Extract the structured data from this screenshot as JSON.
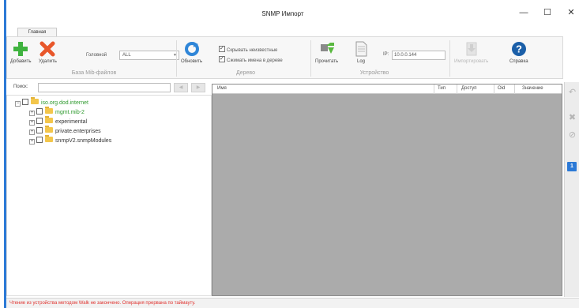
{
  "window": {
    "title": "SNMP Импорт",
    "minimize": "—",
    "maximize": "☐",
    "close": "✕"
  },
  "ribbon": {
    "tab": "Главная",
    "mib_group": {
      "label": "База Mib-файлов",
      "add_label": "Добавить",
      "delete_label": "Удалить",
      "root_label": "Головной",
      "root_value": "ALL"
    },
    "tree_group": {
      "label": "Дерево",
      "refresh_label": "Обновить",
      "hide_unknown_label": "Скрывать неизвестные",
      "collapse_names_label": "Сжимать имена в дереве"
    },
    "device_group": {
      "label": "Устройство",
      "read_label": "Прочитать",
      "log_label": "Log",
      "ip_label": "IP:",
      "ip_value": "10.0.0.144"
    },
    "import_label": "Импортировать",
    "help_label": "Справка"
  },
  "search": {
    "label": "Поиск:",
    "value": ""
  },
  "tree": {
    "root": "iso.org.dod.internet",
    "children": [
      "mgmt.mib-2",
      "experimental",
      "private.enterprises",
      "snmpV2.snmpModules"
    ]
  },
  "grid": {
    "columns": [
      "Имя",
      "Тип",
      "Доступ",
      "Oid",
      "Значение"
    ]
  },
  "right_toolbar": {
    "badge": "1"
  },
  "status": {
    "message": "Чтение из устройства методом Walk не закончено. Операция прервана по таймауту."
  },
  "colors": {
    "accent": "#2b79d6",
    "grid_background": "#ababab",
    "tree_green": "#2e9a2e",
    "status_error": "#e0332f"
  },
  "icons": {
    "add": "plus-icon",
    "delete": "x-icon",
    "refresh": "refresh-icon",
    "read": "download-arrow-icon",
    "log": "document-icon",
    "import": "import-icon",
    "help": "help-icon"
  }
}
